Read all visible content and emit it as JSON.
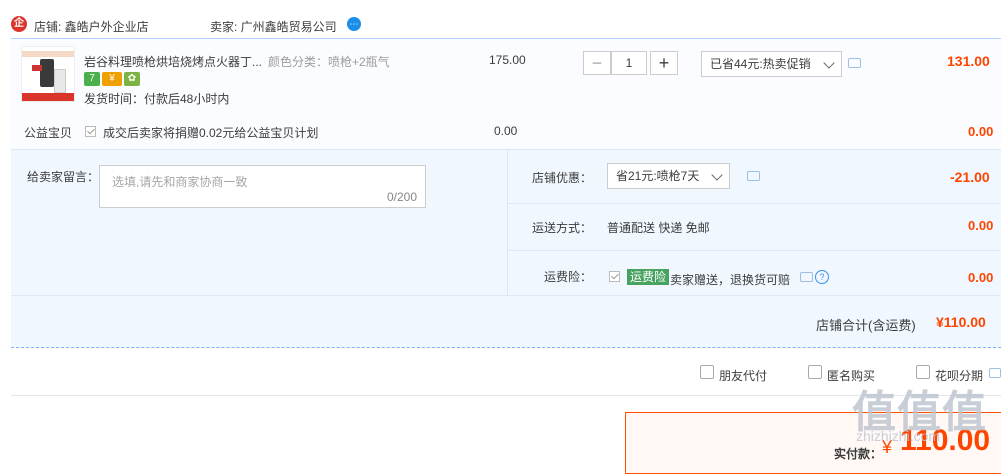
{
  "shop": {
    "logo_text": "企",
    "label": "店铺: 鑫皓户外企业店",
    "seller": "卖家: 广州鑫皓贸易公司",
    "wangwang_icon": "chat-bubble-icon"
  },
  "item": {
    "title": "岩谷料理喷枪烘培烧烤点火器丁...",
    "sku": "颜色分类：喷枪+2瓶气",
    "price": "175.00",
    "quantity": "1",
    "minus": "−",
    "plus": "+",
    "promo": "已省44元:热卖促销",
    "subtotal": "131.00",
    "delivery": "发货时间：付款后48小时内",
    "badges": [
      {
        "text": "7",
        "color": "#4bb04b"
      },
      {
        "text": "¥",
        "color": "#f0a000"
      },
      {
        "text": "✿",
        "color": "#7cb342"
      }
    ]
  },
  "charity": {
    "label": "公益宝贝",
    "text": "成交后卖家将捐赠0.02元给公益宝贝计划",
    "price": "0.00",
    "total": "0.00"
  },
  "message": {
    "label": "给卖家留言：",
    "placeholder": "选填,请先和商家协商一致",
    "counter": "0/200"
  },
  "discount": {
    "label": "店铺优惠：",
    "value": "省21元:喷枪7天",
    "amount": "-21.00"
  },
  "shipping": {
    "label": "运送方式：",
    "value": "普通配送 快递 免邮",
    "amount": "0.00"
  },
  "insurance": {
    "label": "运费险：",
    "tag": "运费险",
    "text": "卖家赠送，退换货可赔",
    "amount": "0.00"
  },
  "shop_total": {
    "label": "店铺合计(含运费)",
    "amount": "¥110.00"
  },
  "options": [
    {
      "label": "朋友代付"
    },
    {
      "label": "匿名购买"
    },
    {
      "label": "花呗分期"
    }
  ],
  "payment": {
    "label": "实付款：",
    "currency": "¥",
    "amount": "110.00"
  },
  "watermark": {
    "logo": "值值值",
    "url": "zhizhizhi.com"
  },
  "colors": {
    "price_red": "#ff4400",
    "accent_blue": "#1a8ee8"
  }
}
